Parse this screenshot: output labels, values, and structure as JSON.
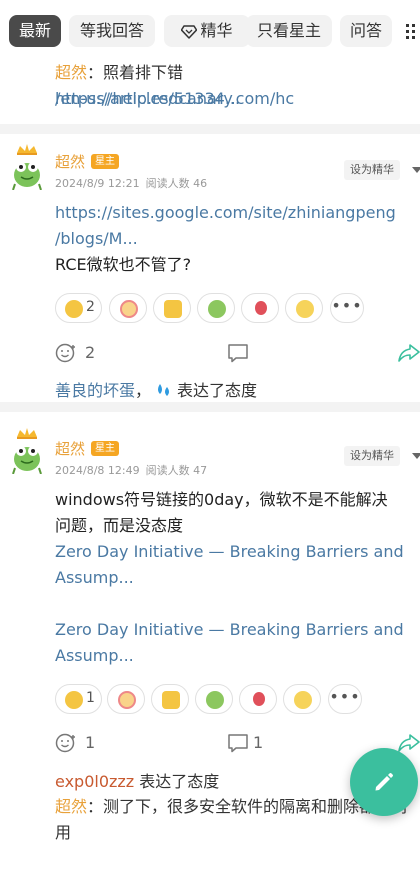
{
  "tabs": [
    {
      "label": "最新",
      "active": true
    },
    {
      "label": "等我回答"
    },
    {
      "label": "精华",
      "icon": "diamond-icon"
    },
    {
      "label": "只看星主"
    },
    {
      "label": "问答"
    }
  ],
  "top_comment": {
    "author": "超然",
    "separator": "：",
    "text": "照着排下错",
    "link_line1": "https://help.redcanary.com/hc",
    "link_line2": "/en-us/articles/51334..."
  },
  "posts": [
    {
      "author": "超然",
      "badge": "星主",
      "date": "2024/8/9 12:21",
      "reads": "阅读人数 46",
      "set_featured": "设为精华",
      "lines": [
        {
          "text": "https://sites.google.com/site/zhiniangpeng",
          "kind": "link"
        },
        {
          "text": "/blogs/M...",
          "kind": "link"
        },
        {
          "text": "RCE微软也不管了?",
          "kind": "text"
        }
      ],
      "like_count": "2",
      "comment_count": "2",
      "share_count": "",
      "reacted_by": "善良的坏蛋",
      "reacted_sep": "，",
      "reacted_text": "表达了态度"
    },
    {
      "author": "超然",
      "badge": "星主",
      "date": "2024/8/8 12:49",
      "reads": "阅读人数 47",
      "set_featured": "设为精华",
      "lines": [
        {
          "text": "windows符号链接的0day，微软不是不能解决",
          "kind": "text"
        },
        {
          "text": "问题，而是没态度",
          "kind": "text"
        },
        {
          "text": "Zero Day Initiative — Breaking Barriers and",
          "kind": "link"
        },
        {
          "text": "Assump...",
          "kind": "link"
        },
        {
          "text": "Zero Day Initiative — Breaking Barriers and",
          "kind": "link"
        },
        {
          "text": "Assump...",
          "kind": "link"
        }
      ],
      "like_count": "1",
      "comment_count": "1",
      "share_count": "1",
      "reacted_by": "exp0l0zzz",
      "reacted_text": "表达了态度",
      "reply_author": "超然",
      "reply_sep": "：",
      "reply_line1": "测了下，很多安全软件的隔离和删除都",
      "reply_tail": "同",
      "reply_line2": "用"
    }
  ],
  "colors": {
    "accent_orange": "#e8a13a",
    "link_blue": "#4a79a3",
    "fab_green": "#3bbf9e"
  }
}
